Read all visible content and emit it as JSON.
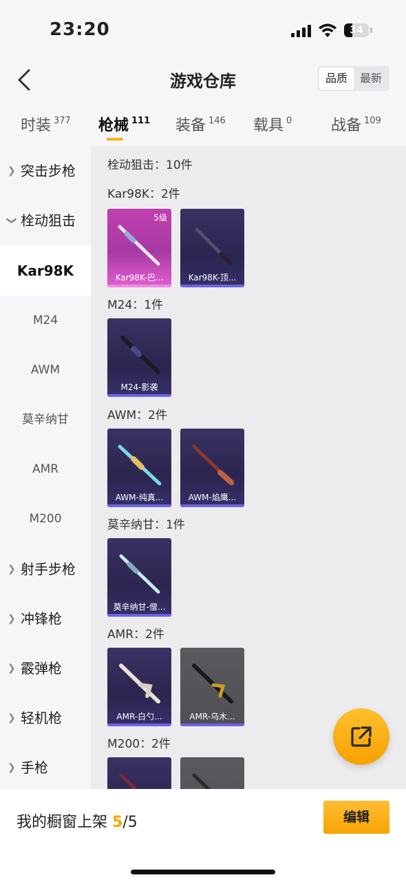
{
  "status": {
    "time": "23:20",
    "battery": "34",
    "battery_level": 0.34
  },
  "nav": {
    "title": "游戏仓库",
    "sort_options": [
      "品质",
      "最新"
    ]
  },
  "tabs": [
    {
      "label": "时装",
      "count": "377"
    },
    {
      "label": "枪械",
      "count": "111"
    },
    {
      "label": "装备",
      "count": "146"
    },
    {
      "label": "载具",
      "count": "0"
    },
    {
      "label": "战备",
      "count": "109"
    }
  ],
  "sidebar": {
    "groups": [
      "突击步枪",
      "栓动狙击",
      "射手步枪",
      "冲锋枪",
      "霰弹枪",
      "轻机枪",
      "手枪"
    ],
    "subitems": [
      "Kar98K",
      "M24",
      "AWM",
      "莫辛纳甘",
      "AMR",
      "M200"
    ]
  },
  "content": {
    "category_header": "栓动狙击：10件",
    "sections": [
      {
        "title": "Kar98K：2件",
        "items": [
          {
            "name": "Kar98K-巴...",
            "level": "5级"
          },
          {
            "name": "Kar98K-顶..."
          }
        ]
      },
      {
        "title": "M24：1件",
        "items": [
          {
            "name": "M24-影袭"
          }
        ]
      },
      {
        "title": "AWM：2件",
        "items": [
          {
            "name": "AWM-纯真..."
          },
          {
            "name": "AWM-焰鹰..."
          }
        ]
      },
      {
        "title": "莫辛纳甘：1件",
        "items": [
          {
            "name": "莫辛纳甘-僧..."
          }
        ]
      },
      {
        "title": "AMR：2件",
        "items": [
          {
            "name": "AMR-白勺..."
          },
          {
            "name": "AMR-乌木..."
          }
        ]
      },
      {
        "title": "M200：2件",
        "items": []
      }
    ]
  },
  "bottom": {
    "shelf_label": "我的橱窗上架",
    "shelf_count": "5",
    "shelf_total": "/5",
    "edit_label": "编辑"
  },
  "colors": {
    "accent": "#f6b01e",
    "card_purple": "#b33fad",
    "card_dark": "#2f2856"
  },
  "icons": {
    "back": "chevron-left-icon",
    "fab": "share-external-icon"
  }
}
